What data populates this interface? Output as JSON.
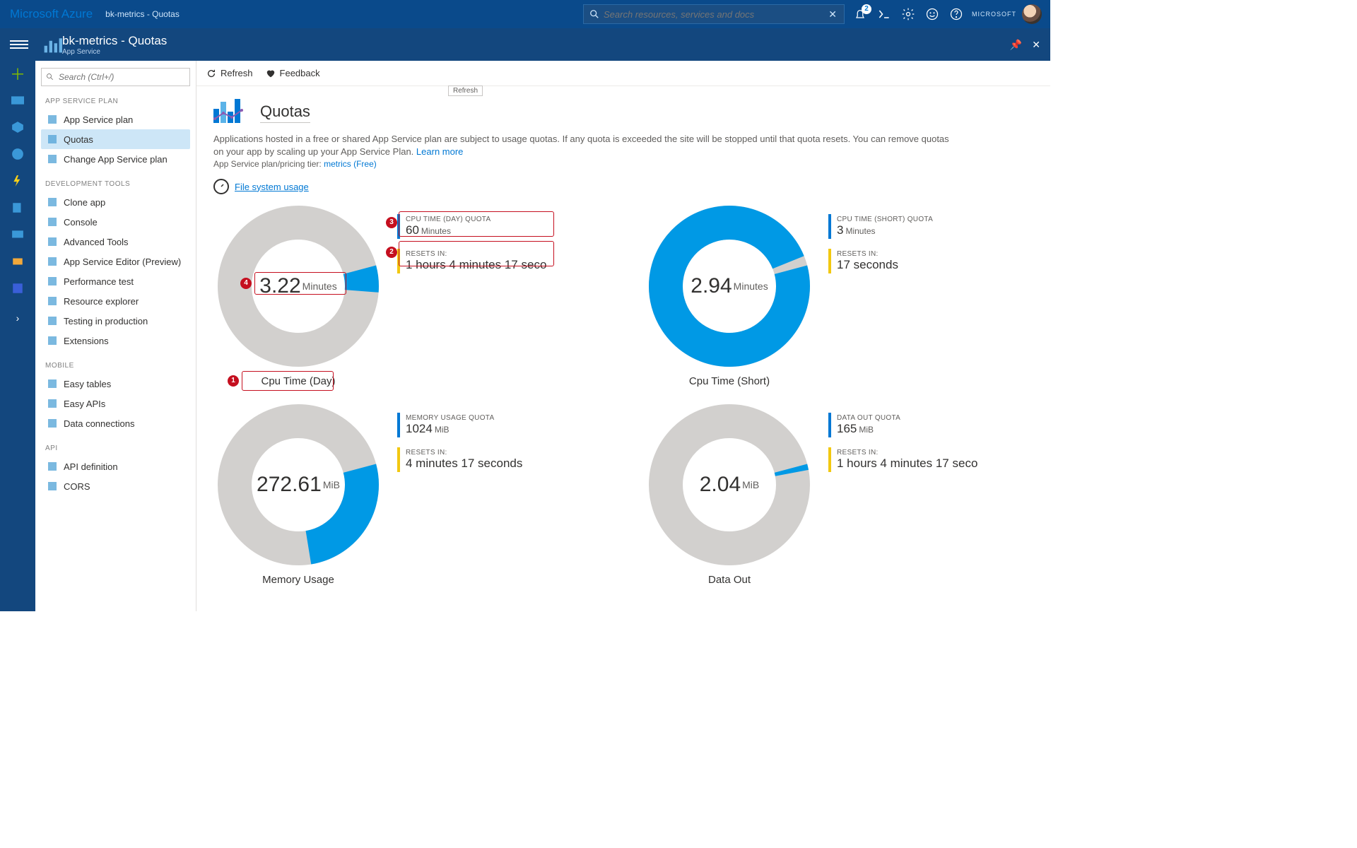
{
  "header": {
    "brand": "Microsoft Azure",
    "breadcrumb": "bk-metrics - Quotas",
    "search_placeholder": "Search resources, services and docs",
    "notification_count": "2",
    "tenant": "MICROSOFT"
  },
  "blade": {
    "title": "bk-metrics - Quotas",
    "subtitle": "App Service"
  },
  "nav": {
    "search_placeholder": "Search (Ctrl+/)",
    "groups": [
      {
        "label": "APP SERVICE PLAN",
        "items": [
          "App Service plan",
          "Quotas",
          "Change App Service plan"
        ],
        "selected": 1
      },
      {
        "label": "DEVELOPMENT TOOLS",
        "items": [
          "Clone app",
          "Console",
          "Advanced Tools",
          "App Service Editor (Preview)",
          "Performance test",
          "Resource explorer",
          "Testing in production",
          "Extensions"
        ]
      },
      {
        "label": "MOBILE",
        "items": [
          "Easy tables",
          "Easy APIs",
          "Data connections"
        ]
      },
      {
        "label": "API",
        "items": [
          "API definition",
          "CORS"
        ]
      }
    ]
  },
  "commands": {
    "refresh": "Refresh",
    "feedback": "Feedback",
    "tooltip": "Refresh"
  },
  "page": {
    "title": "Quotas",
    "intro": "Applications hosted in a free or shared App Service plan are subject to usage quotas. If any quota is exceeded the site will be stopped until that quota resets. You can remove quotas on your app by scaling up your App Service Plan.",
    "learn_more": "Learn more",
    "tier_prefix": "App Service plan/pricing tier:",
    "tier_link": "metrics (Free)",
    "fs_link": "File system usage"
  },
  "chart_data": [
    {
      "type": "pie",
      "name": "Cpu Time (Day)",
      "value": 3.22,
      "unit": "Minutes",
      "quota_label": "CPU TIME (DAY) QUOTA",
      "quota_value": "60",
      "quota_unit": "Minutes",
      "resets_label": "RESETS IN:",
      "resets_value": "1 hours 4 minutes 17 seco",
      "pct": 5.4
    },
    {
      "type": "pie",
      "name": "Cpu Time (Short)",
      "value": 2.94,
      "unit": "Minutes",
      "quota_label": "CPU TIME (SHORT) QUOTA",
      "quota_value": "3",
      "quota_unit": "Minutes",
      "resets_label": "RESETS IN:",
      "resets_value": "17 seconds",
      "pct": 98
    },
    {
      "type": "pie",
      "name": "Memory Usage",
      "value": 272.61,
      "unit": "MiB",
      "quota_label": "MEMORY USAGE QUOTA",
      "quota_value": "1024",
      "quota_unit": "MiB",
      "resets_label": "RESETS IN:",
      "resets_value": "4 minutes 17 seconds",
      "pct": 26.6
    },
    {
      "type": "pie",
      "name": "Data Out",
      "value": 2.04,
      "unit": "MiB",
      "quota_label": "DATA OUT QUOTA",
      "quota_value": "165",
      "quota_unit": "MiB",
      "resets_label": "RESETS IN:",
      "resets_value": "1 hours 4 minutes 17 seco",
      "pct": 1.2
    }
  ],
  "callouts": [
    "1",
    "2",
    "3",
    "4"
  ]
}
